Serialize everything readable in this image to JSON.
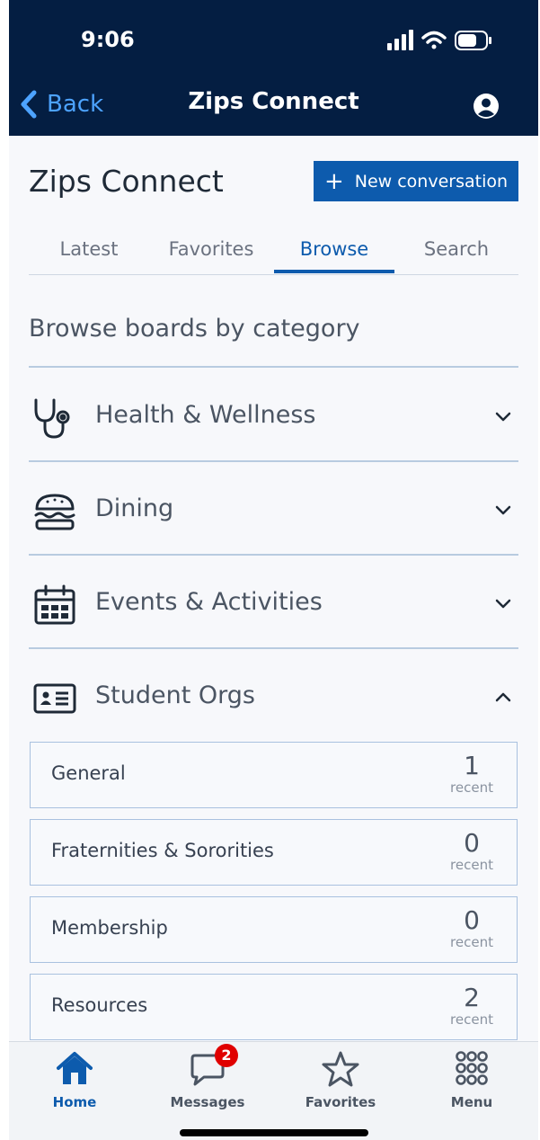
{
  "status": {
    "time": "9:06"
  },
  "nav": {
    "back_label": "Back",
    "title": "Zips Connect"
  },
  "header": {
    "title": "Zips Connect",
    "new_button_label": "New conversation",
    "new_button_plus": "+"
  },
  "tabs": [
    {
      "label": "Latest"
    },
    {
      "label": "Favorites"
    },
    {
      "label": "Browse",
      "active": true
    },
    {
      "label": "Search"
    }
  ],
  "section_heading": "Browse boards by category",
  "categories": [
    {
      "label": "Health & Wellness",
      "icon": "stethoscope-icon",
      "expanded": false
    },
    {
      "label": "Dining",
      "icon": "burger-icon",
      "expanded": false
    },
    {
      "label": "Events & Activities",
      "icon": "calendar-icon",
      "expanded": false
    },
    {
      "label": "Student Orgs",
      "icon": "id-card-icon",
      "expanded": true
    }
  ],
  "boards": [
    {
      "name": "General",
      "count": "1",
      "count_label": "recent"
    },
    {
      "name": "Fraternities & Sororities",
      "count": "0",
      "count_label": "recent"
    },
    {
      "name": "Membership",
      "count": "0",
      "count_label": "recent"
    },
    {
      "name": "Resources",
      "count": "2",
      "count_label": "recent"
    }
  ],
  "bottom_nav": [
    {
      "label": "Home",
      "icon": "home-icon",
      "active": true
    },
    {
      "label": "Messages",
      "icon": "chat-icon",
      "badge": "2"
    },
    {
      "label": "Favorites",
      "icon": "star-icon"
    },
    {
      "label": "Menu",
      "icon": "grid-icon"
    }
  ],
  "colors": {
    "nav_bg": "#041e42",
    "accent": "#0d5bad",
    "badge": "#e00000"
  }
}
